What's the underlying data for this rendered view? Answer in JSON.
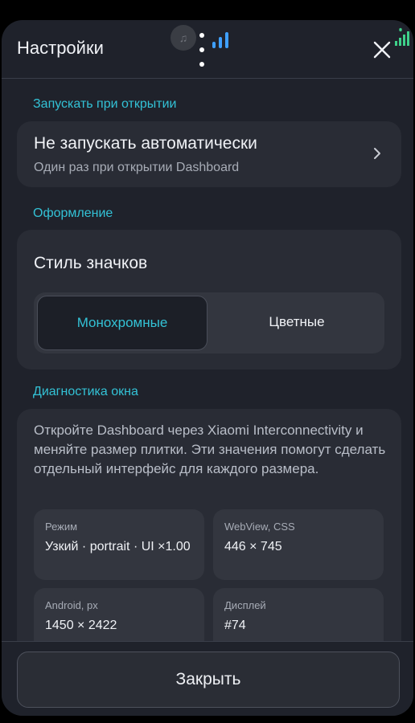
{
  "header": {
    "title": "Настройки",
    "close_icon": "close-icon"
  },
  "status": {
    "music_icon": "♫",
    "bars_color": "#3fa0ff"
  },
  "launch_section": {
    "title": "Запускать при открытии",
    "option_title": "Не запускать автоматически",
    "option_subtitle": "Один раз при открытии Dashboard"
  },
  "appearance_section": {
    "title": "Оформление",
    "icon_style_label": "Стиль значков",
    "options": [
      {
        "label": "Монохромные",
        "selected": true
      },
      {
        "label": "Цветные",
        "selected": false
      }
    ]
  },
  "diagnostics_section": {
    "title": "Диагностика окна",
    "description": "Откройте Dashboard через Xiaomi Interconnectivity и меняйте размер плитки. Эти значения помогут сделать отдельный интерфейс для каждого размера.",
    "cells": [
      {
        "label": "Режим",
        "value": "Узкий · portrait · UI ×1.00"
      },
      {
        "label": "WebView, CSS",
        "value": "446 × 745"
      },
      {
        "label": "Android, px",
        "value": "1450 × 2422"
      },
      {
        "label": "Дисплей",
        "value": "#74"
      }
    ]
  },
  "footer": {
    "close_label": "Закрыть"
  },
  "colors": {
    "accent": "#33c2d6",
    "background": "#1f222b",
    "card": "#292c35"
  }
}
